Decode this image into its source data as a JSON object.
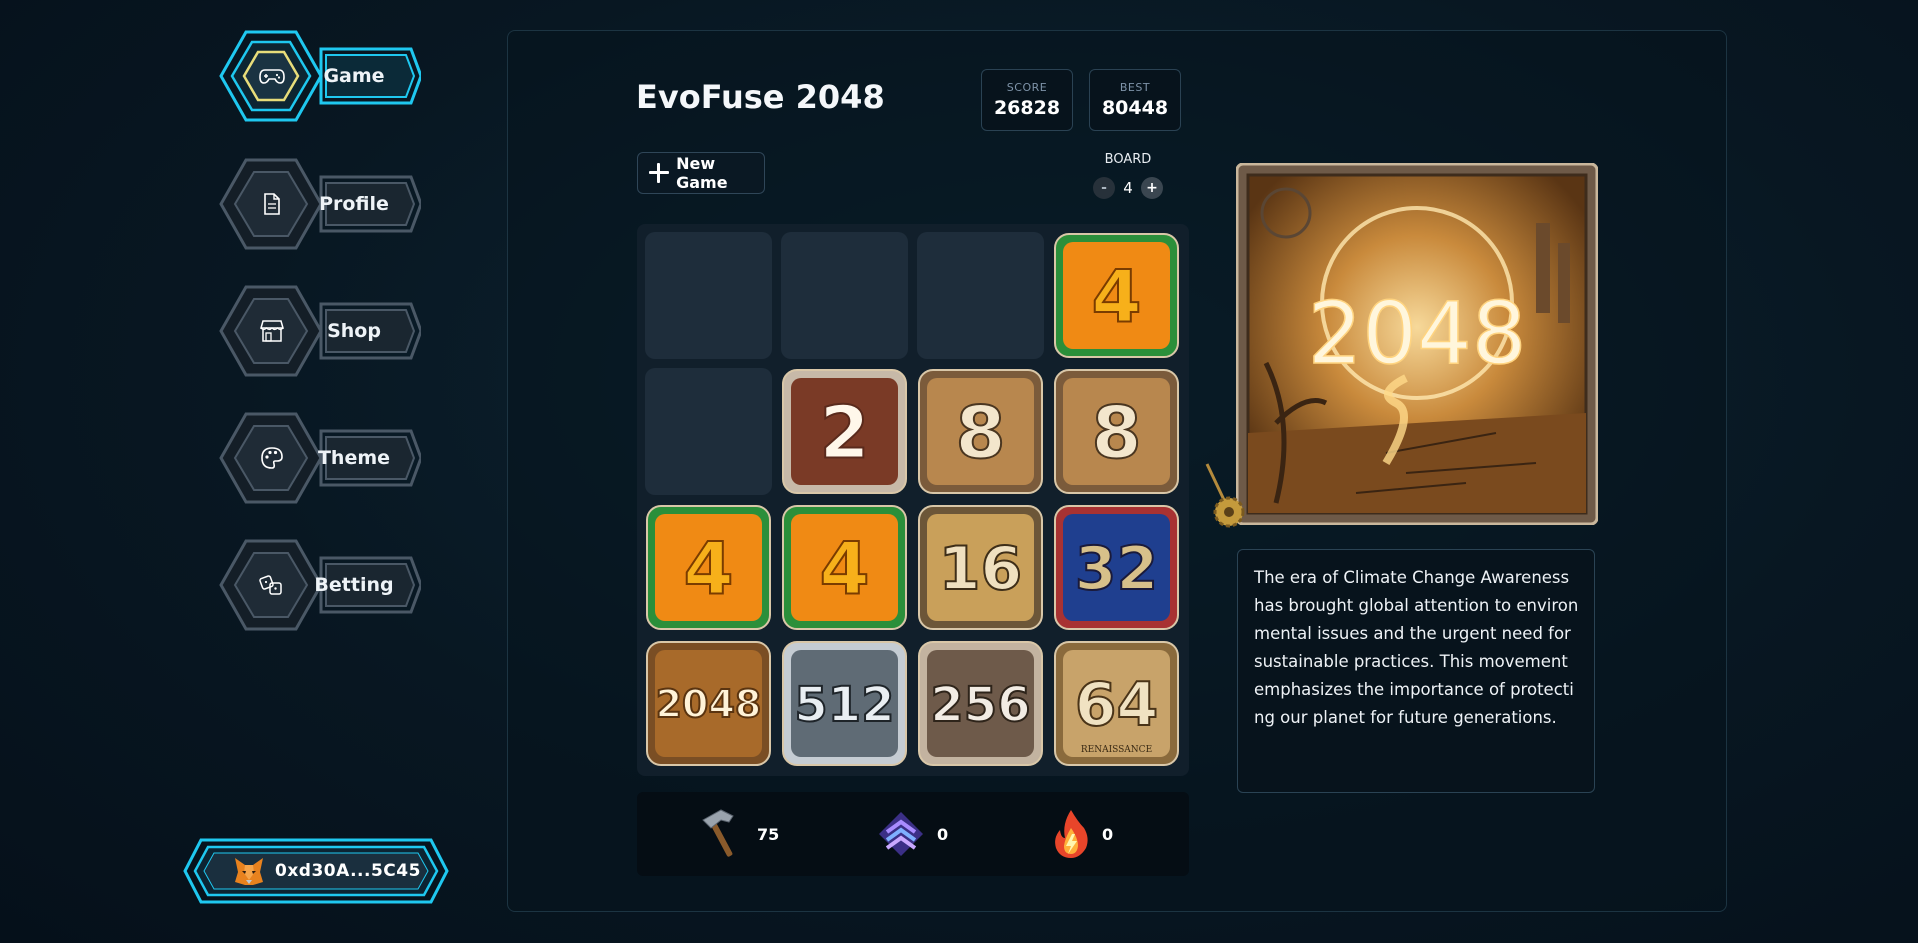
{
  "nav": {
    "items": [
      {
        "label": "Game",
        "icon": "gamepad-icon",
        "active": true
      },
      {
        "label": "Profile",
        "icon": "document-icon",
        "active": false
      },
      {
        "label": "Shop",
        "icon": "store-icon",
        "active": false
      },
      {
        "label": "Theme",
        "icon": "palette-icon",
        "active": false
      },
      {
        "label": "Betting",
        "icon": "dice-icon",
        "active": false
      }
    ]
  },
  "wallet": {
    "address": "0xd30A...5C45",
    "icon": "fox-icon"
  },
  "game": {
    "title": "EvoFuse 2048",
    "score_label": "SCORE",
    "score": "26828",
    "best_label": "BEST",
    "best": "80448",
    "new_game_label": "New Game",
    "board_label": "BOARD",
    "board_size": "4",
    "minus_label": "-",
    "plus_label": "+",
    "tiles": [
      [
        null,
        null,
        null,
        4
      ],
      [
        null,
        2,
        8,
        8
      ],
      [
        4,
        4,
        16,
        32
      ],
      [
        2048,
        512,
        256,
        64
      ]
    ],
    "tile_captions": {
      "64": "RENAISSANCE"
    }
  },
  "boosters": [
    {
      "icon": "hammer-icon",
      "count": "75"
    },
    {
      "icon": "upgrade-chevrons-icon",
      "count": "0"
    },
    {
      "icon": "fire-icon",
      "count": "0"
    }
  ],
  "featured": {
    "value": "2048",
    "description": "The era of Climate Change Awareness has brought global attention to environmental issues and the urgent need for sustainable practices. This movement emphasizes the importance of protecting our planet for future generations."
  },
  "colors": {
    "accent_cyan": "#1fc8f0",
    "active_hex_inner": "#e8dd7a",
    "background": "#081722"
  }
}
